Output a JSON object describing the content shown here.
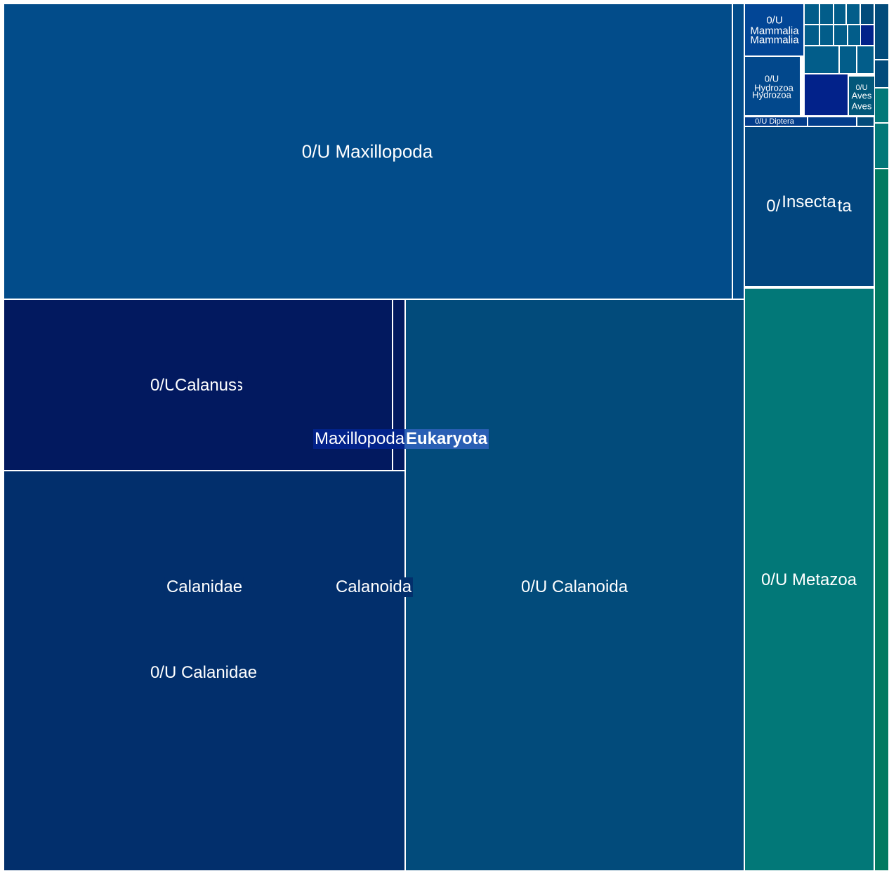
{
  "chart_data": {
    "type": "treemap",
    "root": "Eukaryota",
    "colors": {
      "maxillopoda_rect": "#024c8a",
      "calanus": "#02195f",
      "calanidae": "#022f6c",
      "calanoida": "#024b7b",
      "metazoa": "#027878",
      "insecta": "#02467f",
      "mammalia": "#024696",
      "hydrozoa": "#02488c",
      "aves": "#02577a",
      "diptera": "#023d8c",
      "teal_strip": "#027a60",
      "small_blue": "#025d8a",
      "small_dark": "#02228a",
      "label_highlight": "#2a5fb4"
    },
    "labels": {
      "maxillopoda_unassigned": "0/U Maxillopoda",
      "calanus_unassigned": "0/U Calanus",
      "calanus": "Calanus",
      "maxillopoda": "Maxillopoda",
      "eukaryota": "Eukaryota",
      "calanidae": "Calanidae",
      "calanidae_unassigned": "0/U Calanidae",
      "calanoida": "Calanoida",
      "calanoida_unassigned": "0/U Calanoida",
      "metazoa_unassigned": "0/U Metazoa",
      "insecta_unassigned": "0/U Insecta",
      "insecta": "Insecta",
      "mammalia_unassigned_prefix": "0/U",
      "mammalia_a": "Mammalia",
      "mammalia_b": "Mammalia",
      "hydrozoa_unassigned_prefix": "0/U",
      "hydrozoa_a": "Hydrozoa",
      "hydrozoa_b": "Hydrozoa",
      "aves_unassigned_prefix": "0/U",
      "aves_a": "Aves",
      "aves_b": "Aves",
      "diptera_unassigned": "0/U Diptera"
    }
  }
}
